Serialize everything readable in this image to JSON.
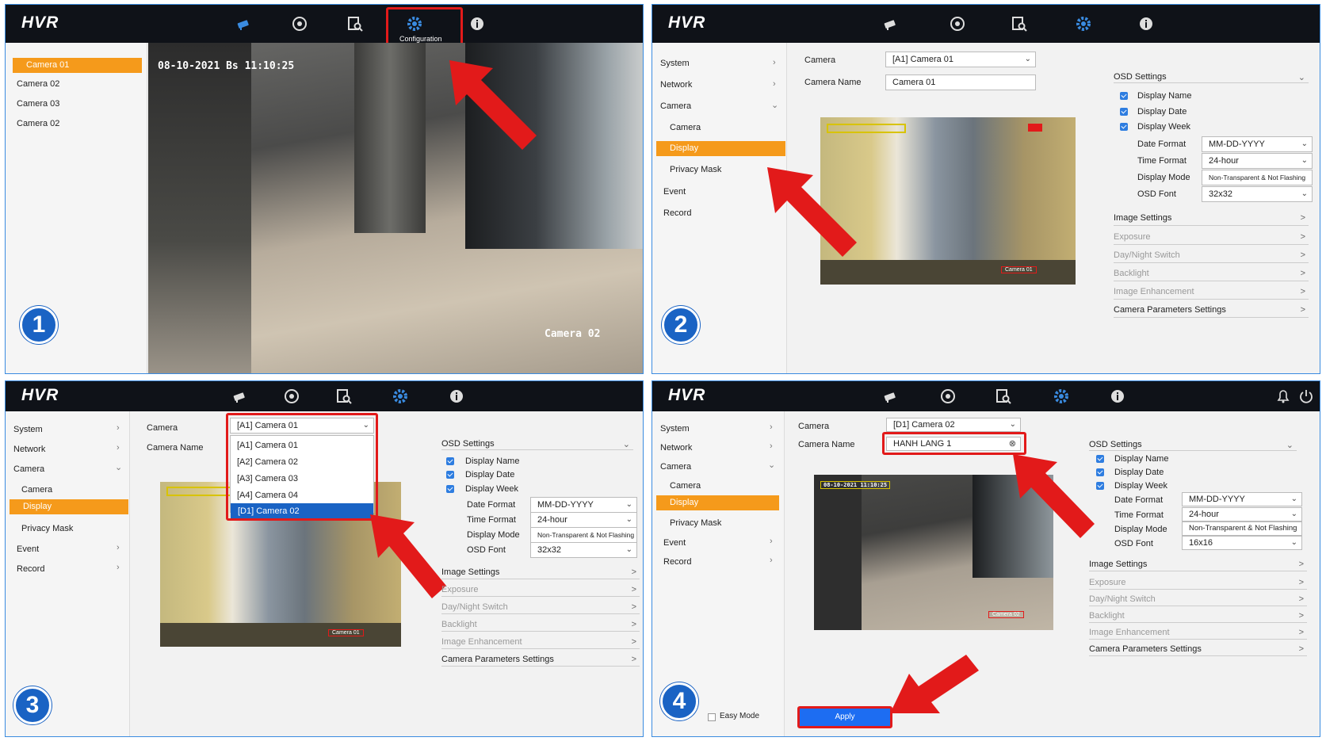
{
  "app": {
    "logo": "HVR",
    "tooltip": "Configuration",
    "badges": [
      "1",
      "2",
      "3",
      "4"
    ]
  },
  "p1": {
    "cameras": [
      "Camera 01",
      "Camera 02",
      "Camera 03",
      "Camera 02"
    ],
    "osd_date": "08-10-2021 Bs  11:10:25",
    "osd_name": "Camera 02"
  },
  "menu": {
    "system": "System",
    "network": "Network",
    "camera": "Camera",
    "sub_camera": "Camera",
    "display": "Display",
    "privacy_mask": "Privacy Mask",
    "event": "Event",
    "record": "Record"
  },
  "form": {
    "camera_label": "Camera",
    "camera_name_label": "Camera Name",
    "camera_select": "[A1] Camera 01",
    "camera_name": "Camera 01",
    "osd_settings": "OSD Settings",
    "display_name": "Display Name",
    "display_date": "Display Date",
    "display_week": "Display Week",
    "date_format_label": "Date Format",
    "time_format_label": "Time Format",
    "display_mode_label": "Display Mode",
    "osd_font_label": "OSD Font",
    "date_format": "MM-DD-YYYY",
    "time_format": "24-hour",
    "display_mode": "Non-Transparent & Not Flashing",
    "osd_font": "32x32",
    "image_settings": "Image Settings",
    "exposure": "Exposure",
    "day_night": "Day/Night Switch",
    "backlight": "Backlight",
    "image_enh": "Image Enhancement",
    "cam_params": "Camera Parameters Settings",
    "preview_tag": "Camera 01"
  },
  "p3": {
    "dropdown": [
      "[A1] Camera 01",
      "[A2] Camera 02",
      "[A3] Camera 03",
      "[A4] Camera 04",
      "[D1] Camera 02"
    ]
  },
  "p4": {
    "camera_select": "[D1] Camera 02",
    "camera_name": "HANH LANG 1",
    "osd_font": "16x16",
    "preview_date": "08-10-2021  11:10:25",
    "preview_tag": "Camera 02",
    "easy_mode": "Easy Mode",
    "apply": "Apply"
  },
  "colors": {
    "accent": "#f59a1b",
    "header": "#0f1218",
    "highlight_blue": "#1a63c4",
    "annotation_red": "#e21a1a"
  }
}
